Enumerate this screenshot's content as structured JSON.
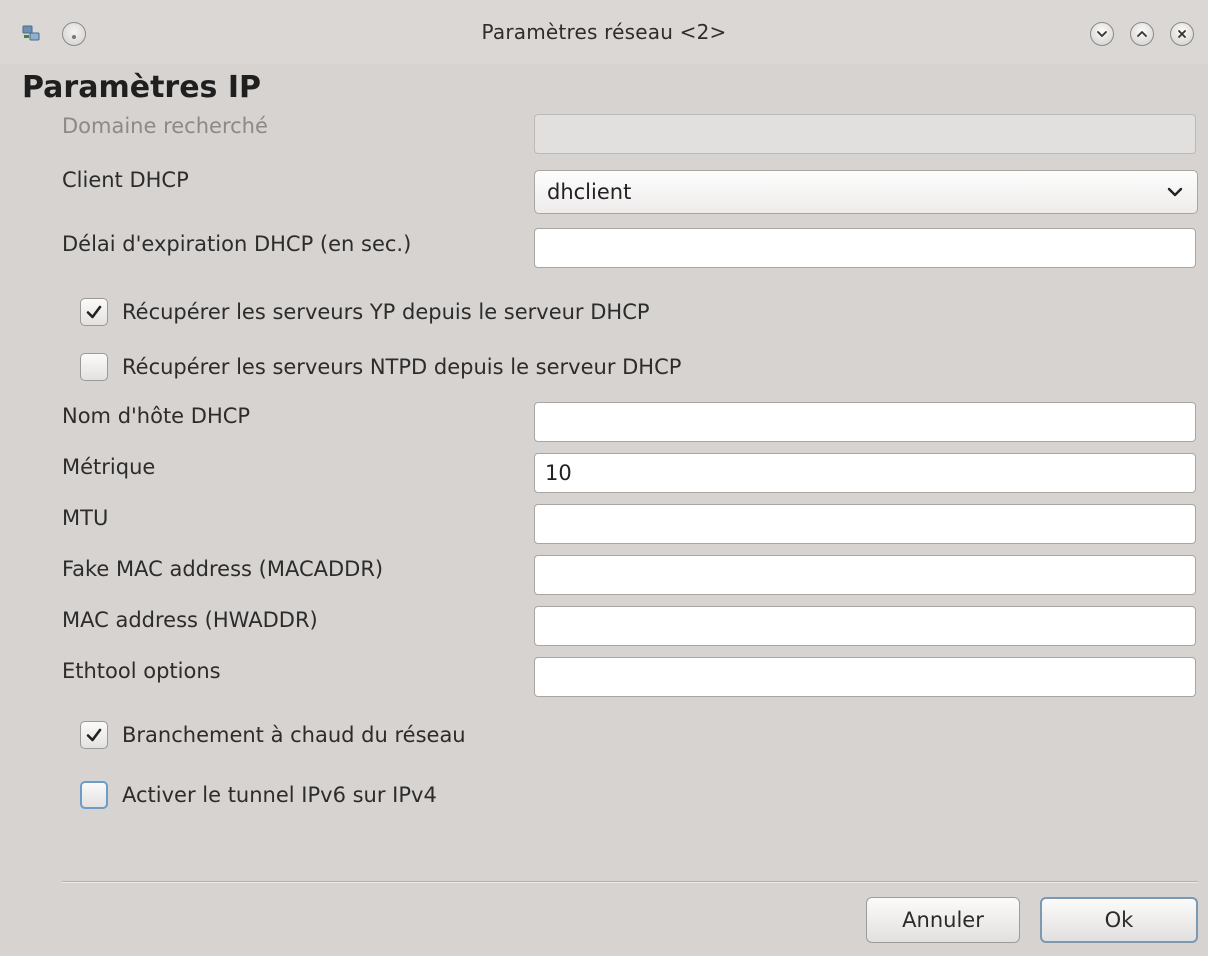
{
  "window": {
    "title": "Paramètres réseau <2>"
  },
  "section_title": "Paramètres IP",
  "fields": {
    "search_domain": {
      "label": "Domaine recherché",
      "value": ""
    },
    "dhcp_client": {
      "label": "Client DHCP",
      "value": "dhclient"
    },
    "dhcp_timeout": {
      "label": "Délai d'expiration DHCP (en sec.)",
      "value": ""
    },
    "dhcp_hostname": {
      "label": "Nom d'hôte DHCP",
      "value": ""
    },
    "metric": {
      "label": "Métrique",
      "value": "10"
    },
    "mtu": {
      "label": "MTU",
      "value": ""
    },
    "fake_mac": {
      "label": "Fake MAC address (MACADDR)",
      "value": ""
    },
    "mac": {
      "label": "MAC address (HWADDR)",
      "value": ""
    },
    "ethtool": {
      "label": "Ethtool options",
      "value": ""
    }
  },
  "checkboxes": {
    "yp": {
      "label": "Récupérer les serveurs YP depuis le serveur DHCP",
      "checked": true
    },
    "ntpd": {
      "label": "Récupérer les serveurs NTPD depuis le serveur DHCP",
      "checked": false
    },
    "hotplug": {
      "label": "Branchement à chaud du réseau",
      "checked": true
    },
    "ipv6_tunnel": {
      "label": "Activer le tunnel IPv6 sur IPv4",
      "checked": false
    }
  },
  "buttons": {
    "cancel": "Annuler",
    "ok": "Ok"
  },
  "icons": {
    "app": "network-icon",
    "menu": "window-menu-icon",
    "minimize": "minimize-icon",
    "maximize": "maximize-icon",
    "close": "close-icon",
    "combo": "chevron-down-icon",
    "check": "checkmark-icon"
  },
  "colors": {
    "background": "#d6d3d0",
    "focus": "#6b9dc9",
    "default_button_border": "#7a99b5"
  }
}
